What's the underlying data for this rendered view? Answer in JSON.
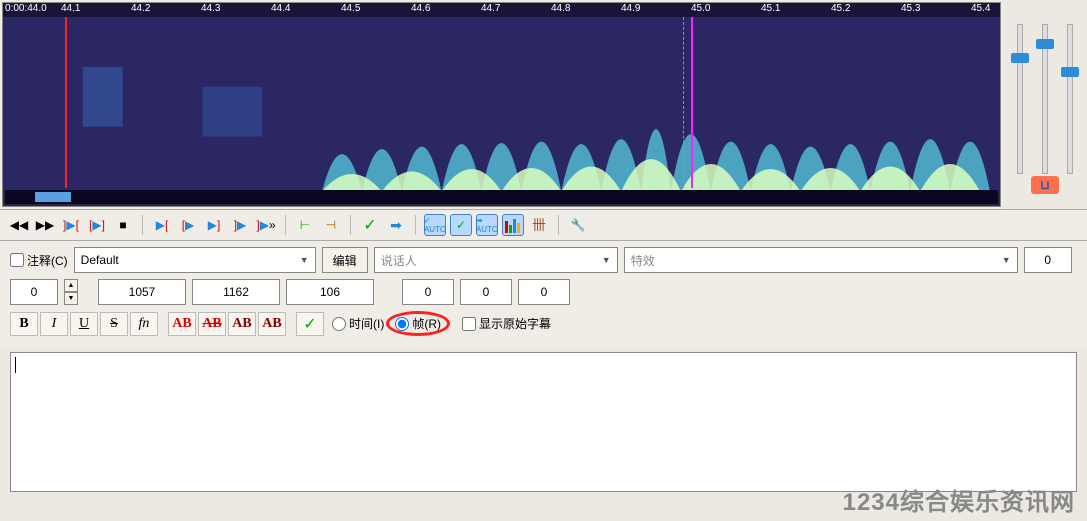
{
  "ruler": {
    "start_label": "0:00:44.0",
    "ticks": [
      "44.1",
      "44.2",
      "44.3",
      "44.4",
      "44.5",
      "44.6",
      "44.7",
      "44.8",
      "44.9",
      "45.0",
      "45.1",
      "45.2",
      "45.3",
      "45.4"
    ]
  },
  "sliders": {
    "pos1": 28,
    "pos2": 14,
    "pos3": 42
  },
  "form": {
    "comment_label": "注释(C)",
    "style_value": "Default",
    "edit_btn": "编辑",
    "actor_placeholder": "说话人",
    "effect_placeholder": "特效",
    "margin_r": "0",
    "layer": "0",
    "start": "1057",
    "end": "1162",
    "duration": "106",
    "ml": "0",
    "mr": "0",
    "mv": "0"
  },
  "fmt": {
    "bold": "B",
    "italic": "I",
    "underline": "U",
    "strike": "S",
    "fn": "fn",
    "ab1": "AB",
    "ab2": "AB",
    "ab3": "AB",
    "ab4": "AB",
    "time_label": "时间(I)",
    "frame_label": "帧(R)",
    "show_orig_label": "显示原始字幕"
  },
  "watermark": "1234综合娱乐资讯网"
}
